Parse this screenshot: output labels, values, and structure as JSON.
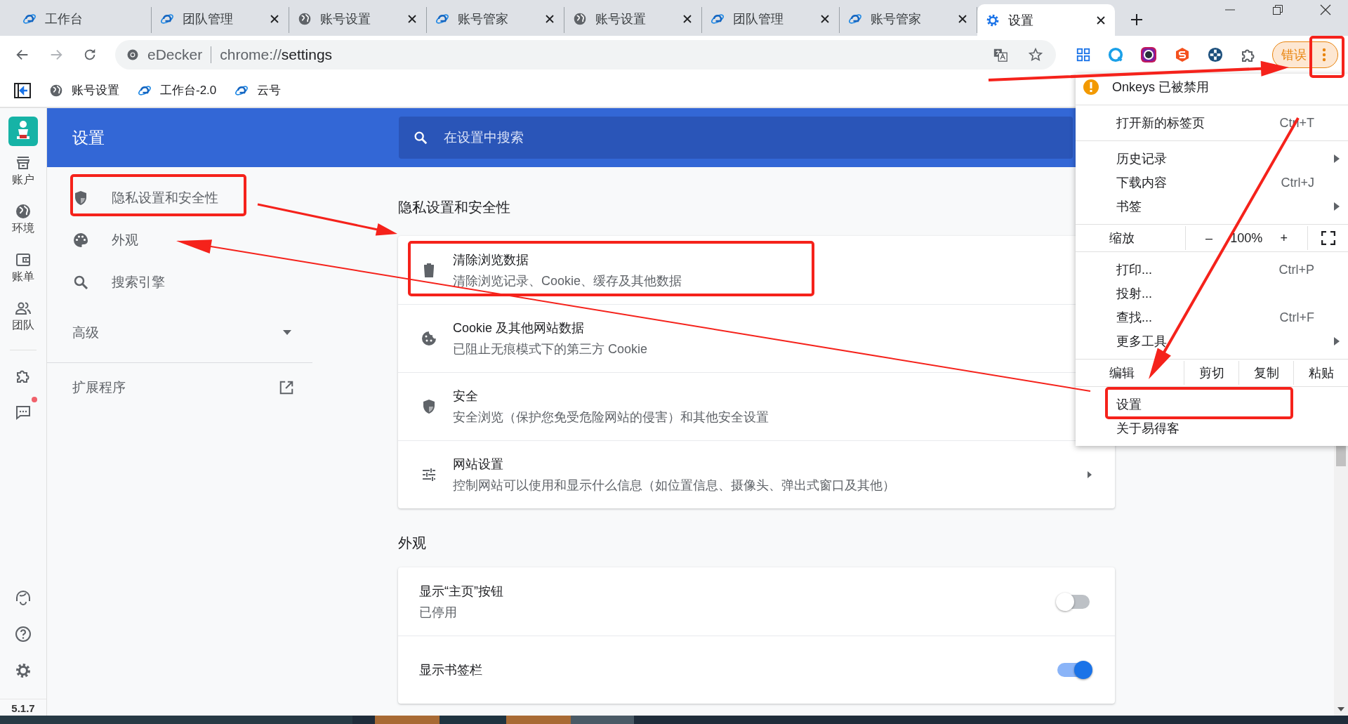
{
  "tabs": [
    {
      "title": "工作台",
      "closable": false,
      "selected": false
    },
    {
      "title": "团队管理",
      "closable": true,
      "selected": false
    },
    {
      "title": "账号设置",
      "closable": true,
      "selected": false
    },
    {
      "title": "账号管家",
      "closable": true,
      "selected": false
    },
    {
      "title": "账号设置",
      "closable": true,
      "selected": false
    },
    {
      "title": "团队管理",
      "closable": true,
      "selected": false
    },
    {
      "title": "账号管家",
      "closable": true,
      "selected": false
    },
    {
      "title": "设置",
      "closable": true,
      "selected": true
    }
  ],
  "nav_buttons": [
    {
      "disabled": false
    },
    {
      "disabled": true
    },
    {
      "disabled": false
    }
  ],
  "address_bar": {
    "site": "eDecker",
    "url_scheme": "chrome://",
    "url_path": "settings"
  },
  "profile_button": {
    "label": "错误"
  },
  "bookmarks": [
    {
      "title": "账号设置"
    },
    {
      "title": "工作台-2.0"
    },
    {
      "title": "云号"
    }
  ],
  "app_sidebar": {
    "items": [
      {
        "label": "账户"
      },
      {
        "label": "环境"
      },
      {
        "label": "账单"
      },
      {
        "label": "团队"
      }
    ],
    "tools": [
      {
        "badge": false
      },
      {
        "badge": true
      }
    ],
    "version": "5.1.7"
  },
  "settings": {
    "title": "设置",
    "search": {
      "placeholder": "在设置中搜索"
    },
    "nav": [
      {
        "label": "隐私设置和安全性"
      },
      {
        "label": "外观"
      },
      {
        "label": "搜索引擎"
      }
    ],
    "advanced": {
      "label": "高级",
      "expanded": false
    },
    "extensions": "扩展程序",
    "sections": [
      {
        "title": "隐私设置和安全性",
        "rows": [
          {
            "kind": "link",
            "title": "清除浏览数据",
            "subtitle": "清除浏览记录、Cookie、缓存及其他数据"
          },
          {
            "kind": "link",
            "title": "Cookie 及其他网站数据",
            "subtitle": "已阻止无痕模式下的第三方 Cookie"
          },
          {
            "kind": "link",
            "title": "安全",
            "subtitle": "安全浏览（保护您免受危险网站的侵害）和其他安全设置"
          },
          {
            "kind": "subpage",
            "title": "网站设置",
            "subtitle": "控制网站可以使用和显示什么信息（如位置信息、摄像头、弹出式窗口及其他）"
          }
        ]
      },
      {
        "title": "外观",
        "rows": [
          {
            "kind": "toggle",
            "title": "显示“主页”按钮",
            "subtitle": "已停用",
            "on": false
          },
          {
            "kind": "toggle",
            "title": "显示书签栏",
            "on": true
          }
        ]
      }
    ]
  },
  "menu": {
    "groups": [
      {
        "items": [
          {
            "kind": "notice",
            "label": "Onkeys 已被禁用"
          }
        ]
      },
      {
        "items": [
          {
            "kind": "item",
            "label": "打开新的标签页",
            "shortcut": "Ctrl+T",
            "submenu": false
          }
        ]
      },
      {
        "items": [
          {
            "kind": "item",
            "label": "历史记录",
            "submenu": true
          },
          {
            "kind": "item",
            "label": "下载内容",
            "shortcut": "Ctrl+J",
            "submenu": false
          },
          {
            "kind": "item",
            "label": "书签",
            "submenu": true
          }
        ]
      },
      {
        "items": [
          {
            "kind": "zoom",
            "label": "缩放",
            "minus": "–",
            "value": "100%",
            "plus": "+"
          }
        ]
      },
      {
        "items": [
          {
            "kind": "item",
            "label": "打印...",
            "shortcut": "Ctrl+P",
            "submenu": false
          },
          {
            "kind": "item",
            "label": "投射...",
            "submenu": false
          },
          {
            "kind": "item",
            "label": "查找...",
            "shortcut": "Ctrl+F",
            "submenu": false
          },
          {
            "kind": "item",
            "label": "更多工具",
            "submenu": true
          }
        ]
      },
      {
        "items": [
          {
            "kind": "edit",
            "label": "编辑",
            "actions": [
              "剪切",
              "复制",
              "粘贴"
            ]
          }
        ]
      },
      {
        "items": [
          {
            "kind": "item",
            "label": "设置",
            "submenu": false
          },
          {
            "kind": "item",
            "label": "关于易得客",
            "submenu": false
          }
        ]
      }
    ]
  }
}
